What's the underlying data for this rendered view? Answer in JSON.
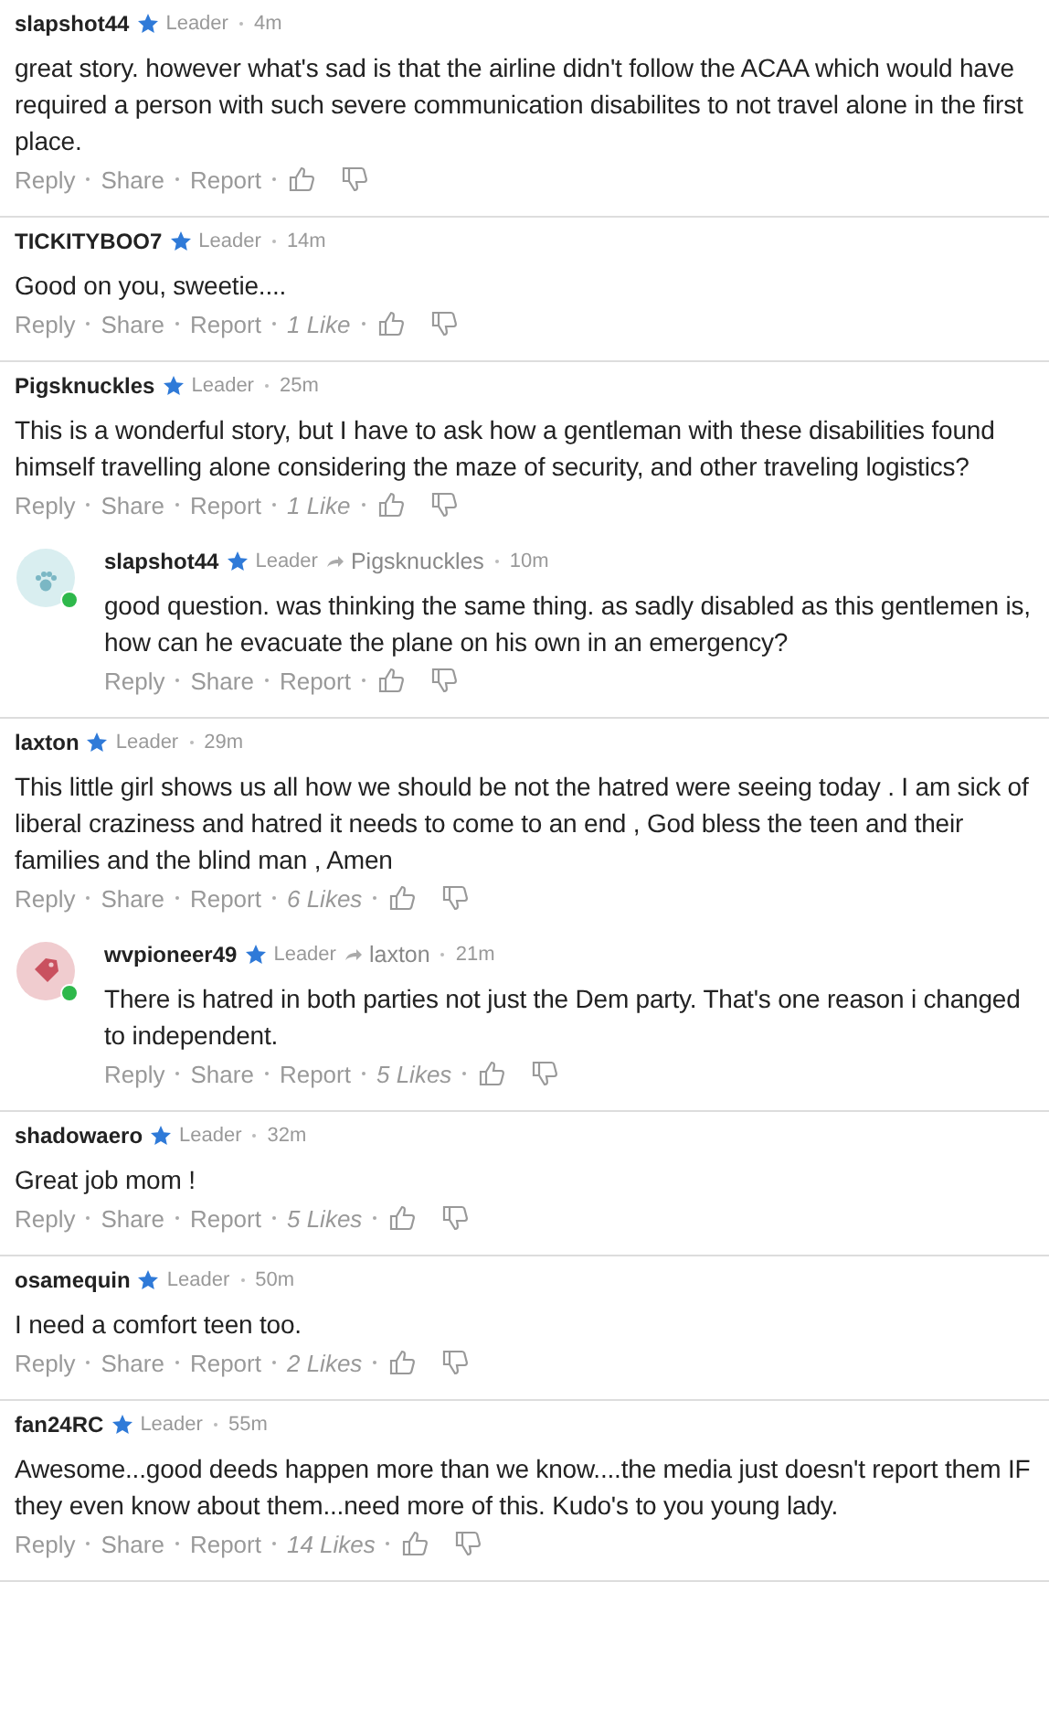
{
  "comments": [
    {
      "author": "slapshot44",
      "badge": "Leader",
      "time": "4m",
      "text": "great story. however what's sad is that the airline didn't follow the ACAA which would have required a person with such severe communication disabilites to not travel alone in the first place.",
      "actions": [
        "Reply",
        "Share",
        "Report"
      ]
    },
    {
      "author": "TICKITYBOO7",
      "badge": "Leader",
      "time": "14m",
      "text": "Good on you, sweetie....",
      "actions": [
        "Reply",
        "Share",
        "Report"
      ],
      "likes": "1 Like"
    },
    {
      "author": "Pigsknuckles",
      "badge": "Leader",
      "time": "25m",
      "text": "This is a wonderful story, but I have to ask how a gentleman with these disabilities found himself travelling alone considering the maze of security, and other traveling logistics?",
      "actions": [
        "Reply",
        "Share",
        "Report"
      ],
      "likes": "1 Like",
      "children": [
        {
          "author": "slapshot44",
          "badge": "Leader",
          "reply_to": "Pigsknuckles",
          "time": "10m",
          "avatar": {
            "kind": "paw",
            "online": true
          },
          "text": "good question. was thinking the same thing. as sadly disabled as this gentlemen is, how can he evacuate the plane on his own in an emergency?",
          "actions": [
            "Reply",
            "Share",
            "Report"
          ]
        }
      ]
    },
    {
      "author": "laxton",
      "badge": "Leader",
      "time": "29m",
      "text": "This little girl shows us all how we should be not the hatred were seeing today .  I am sick of liberal craziness and hatred it needs to come to an end , God bless the teen and their families and the blind man , Amen",
      "actions": [
        "Reply",
        "Share",
        "Report"
      ],
      "likes": "6 Likes",
      "children": [
        {
          "author": "wvpioneer49",
          "badge": "Leader",
          "reply_to": "laxton",
          "time": "21m",
          "avatar": {
            "kind": "tag",
            "online": true
          },
          "text": "There is hatred in both parties not just the Dem party. That's one reason i changed  to independent.",
          "actions": [
            "Reply",
            "Share",
            "Report"
          ],
          "likes": "5 Likes"
        }
      ]
    },
    {
      "author": "shadowaero",
      "badge": "Leader",
      "time": "32m",
      "text": "Great job mom !",
      "actions": [
        "Reply",
        "Share",
        "Report"
      ],
      "likes": "5 Likes"
    },
    {
      "author": "osamequin",
      "badge": "Leader",
      "time": "50m",
      "text": "I need a comfort teen too.",
      "actions": [
        "Reply",
        "Share",
        "Report"
      ],
      "likes": "2 Likes"
    },
    {
      "author": "fan24RC",
      "badge": "Leader",
      "time": "55m",
      "text": "Awesome...good deeds happen more than we know....the media just doesn't report them IF they even know about them...need more of this.  Kudo's to you young lady.",
      "actions": [
        "Reply",
        "Share",
        "Report"
      ],
      "likes": "14 Likes"
    }
  ]
}
